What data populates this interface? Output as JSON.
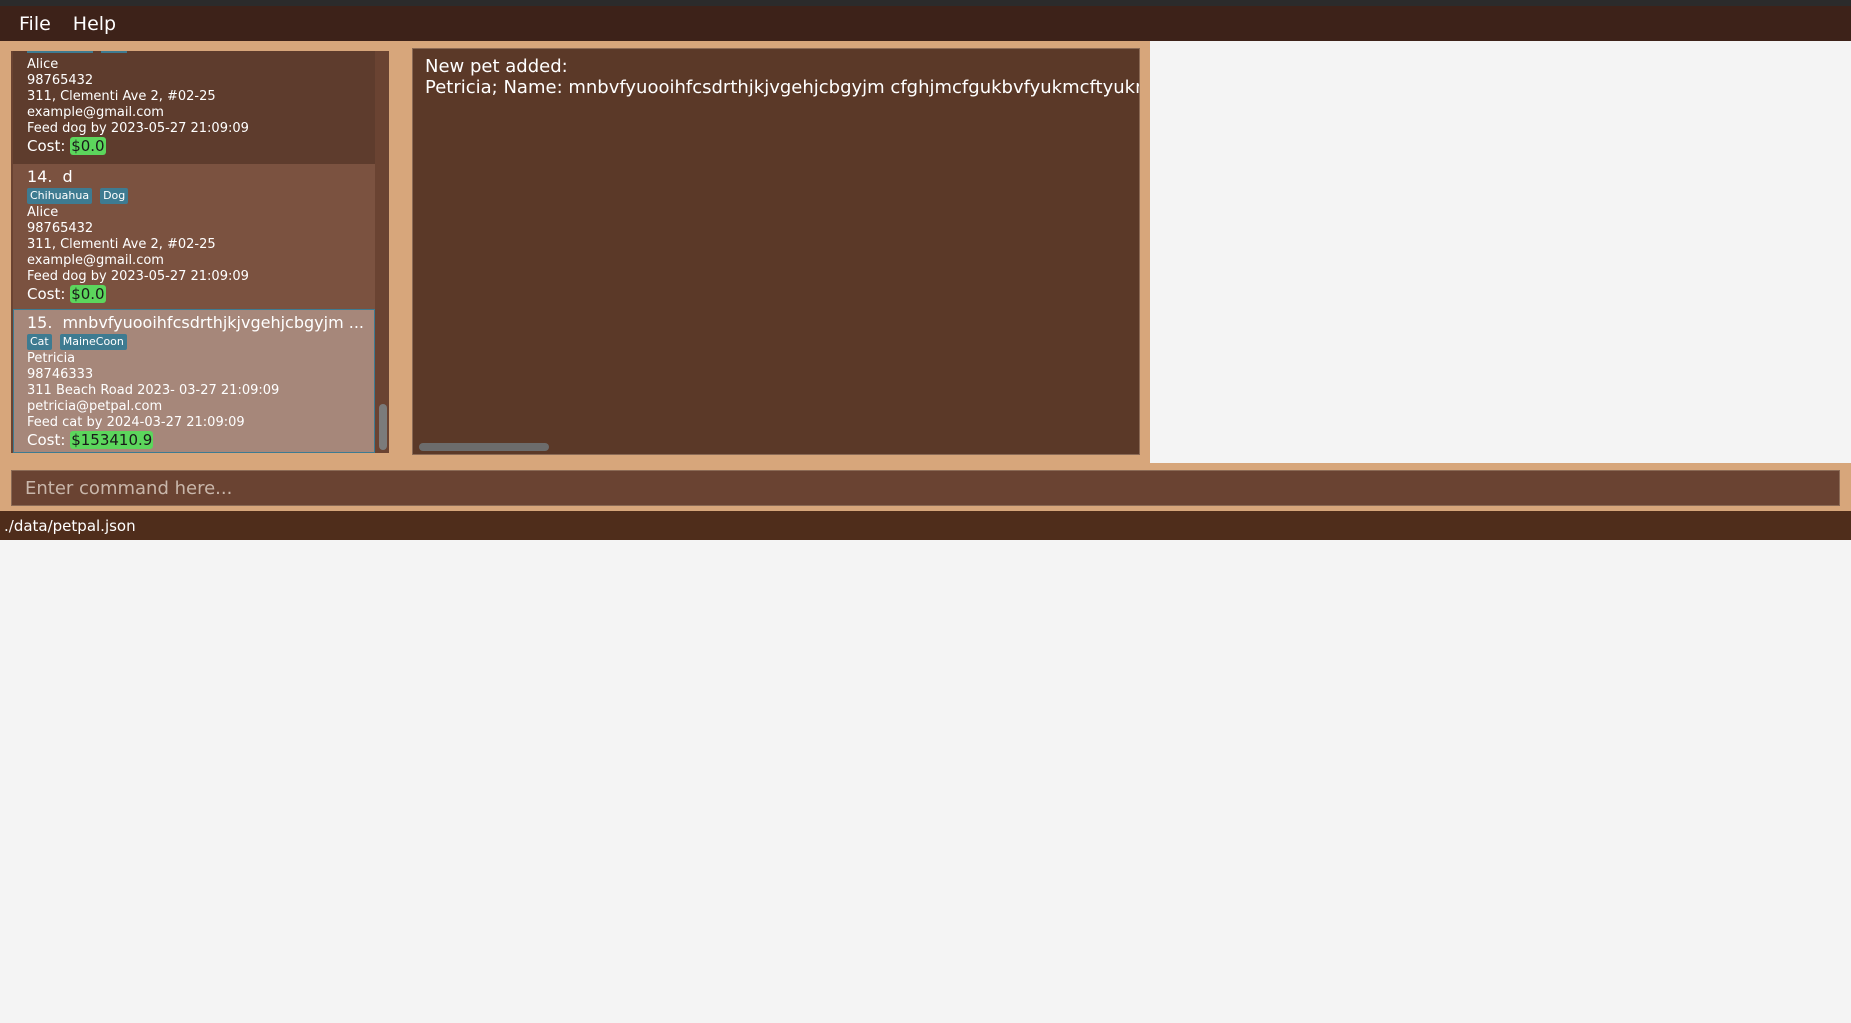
{
  "menu": {
    "file_label": "File",
    "help_label": "Help"
  },
  "list": {
    "cards": [
      {
        "index": "",
        "name": "",
        "tags": [],
        "owner": "Alice",
        "phone": "98765432",
        "address": "311, Clementi Ave 2, #02-25",
        "email": "example@gmail.com",
        "feed": "Feed dog by 2023-05-27 21:09:09",
        "cost_label": "Cost:",
        "cost_value": "$0.0"
      },
      {
        "index": "14.",
        "name": "d",
        "tags": [
          "Chihuahua",
          "Dog"
        ],
        "owner": "Alice",
        "phone": "98765432",
        "address": "311, Clementi Ave 2, #02-25",
        "email": "example@gmail.com",
        "feed": "Feed dog by 2023-05-27 21:09:09",
        "cost_label": "Cost:",
        "cost_value": "$0.0"
      },
      {
        "index": "15.",
        "name": "mnbvfyuooihfcsdrthjkjvgehjcbgyjm ...",
        "tags": [
          "Cat",
          "MaineCoon"
        ],
        "owner": "Petricia",
        "phone": "98746333",
        "address": "311 Beach Road 2023- 03-27 21:09:09",
        "email": "petricia@petpal.com",
        "feed": "Feed cat by 2024-03-27 21:09:09",
        "cost_label": "Cost:",
        "cost_value": "$153410.9"
      }
    ]
  },
  "result": {
    "line1": "New pet added:",
    "line2": "Petricia; Name: mnbvfyuooihfcsdrthjkjvgehjcbgyjm cfghjmcfgukbvfyukmcftyukmb"
  },
  "command": {
    "placeholder": "Enter command here..."
  },
  "status": {
    "file_path": "./data/petpal.json"
  },
  "colors": {
    "menubar": "#3d2219",
    "panel_border": "#d7a67b",
    "list_bg": "#6a4332",
    "result_bg": "#5b3928",
    "tag": "#3e7b91",
    "cost_badge": "#5cd65c",
    "status_bar": "#4f2d1b"
  }
}
